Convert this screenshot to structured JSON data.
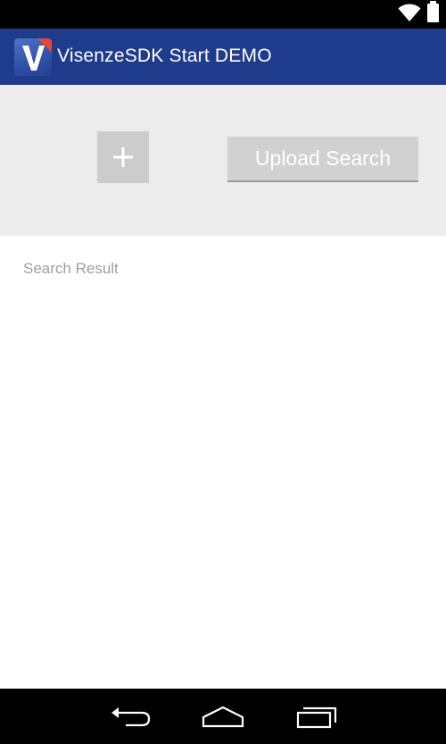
{
  "status_bar": {
    "icons": [
      "wifi-icon",
      "battery-icon"
    ]
  },
  "action_bar": {
    "logo": "app-logo-icon",
    "title": "VisenzeSDK Start DEMO",
    "background": "#1f3c8c"
  },
  "upload_panel": {
    "add_button_icon": "plus-icon",
    "upload_search_label": "Upload Search"
  },
  "results": {
    "label": "Search Result"
  },
  "nav_bar": {
    "icons": [
      "back-icon",
      "home-icon",
      "recents-icon"
    ]
  }
}
